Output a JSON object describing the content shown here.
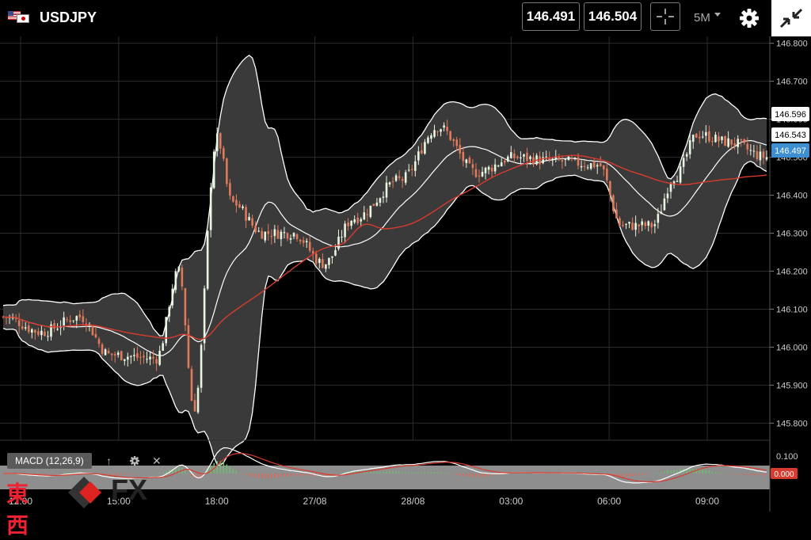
{
  "header": {
    "symbol": "USDJPY",
    "bid": "146.491",
    "ask": "146.504",
    "timeframe": "5M",
    "icons": [
      "us-flag-icon",
      "jp-flag-icon",
      "crosshair-icon",
      "caret-down-icon",
      "gear-icon",
      "collapse-icon"
    ]
  },
  "indicator": {
    "label": "MACD (12,26,9)",
    "tools": [
      "up-arrow-icon",
      "gear-icon",
      "close-icon"
    ],
    "axis_tick": "0.100",
    "value_tag": "0.000"
  },
  "watermark": {
    "kanji": "東西",
    "brand": "FX"
  },
  "colors": {
    "bg": "#000000",
    "band": "#3a3a3a",
    "up": "#e8f5e0",
    "down": "#e07a5a",
    "ma": "#d93a2e",
    "last_price": "#3d8fd1",
    "macd_line": "#ffffff",
    "signal_line": "#d93a2e"
  },
  "chart_data": {
    "type": "candlestick",
    "y_axis_ticks": [
      "146.800",
      "146.700",
      "146.600",
      "146.500",
      "146.400",
      "146.300",
      "146.200",
      "146.100",
      "146.000",
      "145.900",
      "145.800"
    ],
    "ylim": [
      145.755,
      146.818
    ],
    "x_ticks": [
      "12:00",
      "15:00",
      "18:00",
      "27/08",
      "28/08",
      "03:00",
      "06:00",
      "09:00"
    ],
    "price_tags": [
      {
        "label": "146.596",
        "style": "upper-band"
      },
      {
        "label": "146.543",
        "style": "middle-band"
      },
      {
        "label": "146.497",
        "style": "last-price"
      }
    ],
    "indicators": [
      "Bollinger Bands",
      "Moving Average",
      "MACD (12,26,9)"
    ],
    "grid": true,
    "series_points": [
      {
        "t": 0,
        "price": 146.08
      },
      {
        "t": 0.05,
        "price": 146.04
      },
      {
        "t": 0.1,
        "price": 146.08
      },
      {
        "t": 0.14,
        "price": 145.98
      },
      {
        "t": 0.2,
        "price": 145.97
      },
      {
        "t": 0.23,
        "price": 146.2
      },
      {
        "t": 0.25,
        "price": 145.84
      },
      {
        "t": 0.28,
        "price": 146.55
      },
      {
        "t": 0.3,
        "price": 146.38
      },
      {
        "t": 0.34,
        "price": 146.3
      },
      {
        "t": 0.38,
        "price": 146.3
      },
      {
        "t": 0.42,
        "price": 146.22
      },
      {
        "t": 0.46,
        "price": 146.34
      },
      {
        "t": 0.52,
        "price": 146.44
      },
      {
        "t": 0.57,
        "price": 146.58
      },
      {
        "t": 0.62,
        "price": 146.46
      },
      {
        "t": 0.67,
        "price": 146.5
      },
      {
        "t": 0.72,
        "price": 146.49
      },
      {
        "t": 0.78,
        "price": 146.48
      },
      {
        "t": 0.81,
        "price": 146.32
      },
      {
        "t": 0.85,
        "price": 146.32
      },
      {
        "t": 0.88,
        "price": 146.45
      },
      {
        "t": 0.91,
        "price": 146.56
      },
      {
        "t": 0.95,
        "price": 146.54
      },
      {
        "t": 1,
        "price": 146.5
      }
    ]
  }
}
